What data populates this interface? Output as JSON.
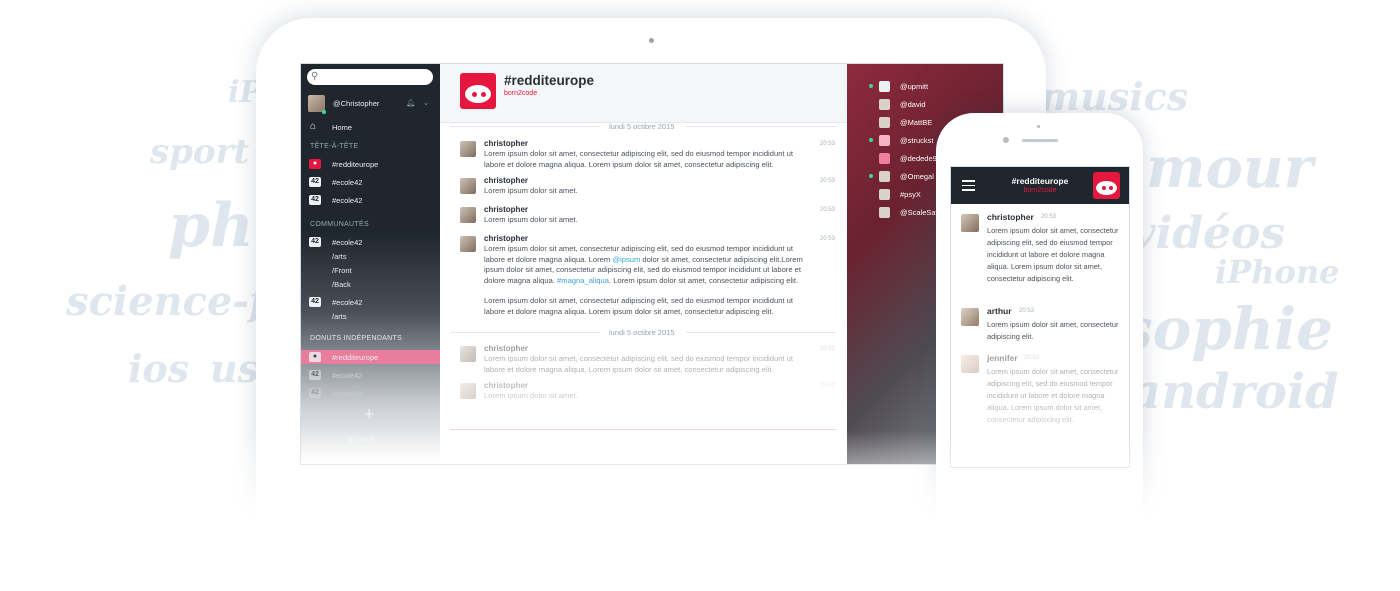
{
  "background_words": [
    "iPad",
    "sport",
    "philo",
    "science-fi",
    "ios",
    "us",
    "musics",
    "amour",
    "vidéos",
    "iPhone",
    "sophie",
    "android"
  ],
  "sidebar": {
    "search_placeholder": "",
    "user": "@Christopher",
    "home": "Home",
    "section_dm": "TÊTE-À-TÊTE",
    "dm_items": [
      "#redditeurope",
      "#ecole42",
      "#ecole42"
    ],
    "section_communities": "COMMUNAUTÉS",
    "community": {
      "name": "#ecole42",
      "subs": [
        "/arts",
        "/Front",
        "/Back"
      ]
    },
    "community2": {
      "name": "#ecole42",
      "subs": [
        "/arts"
      ]
    },
    "section_donuts": "DONUTS INDÉPENDANTS",
    "donut_items": [
      "#redditeurope",
      "#ecole42",
      "#ecole42"
    ],
    "add_label": "+",
    "logo_text": "donut"
  },
  "channel": {
    "name": "#redditeurope",
    "subtitle": "born2code",
    "date1": "lundi 5 octibre 2015",
    "date2": "lundi 5 octibre 2015",
    "messages": [
      {
        "author": "christopher",
        "time": "20:53",
        "text": "Lorem ipsum dolor sit amet, consectetur adipiscing elit, sed do eiusmod tempor incididunt ut labore et dolore magna aliqua. Lorem ipsum dolor sit amet, consectetur adipiscing elit."
      },
      {
        "author": "christopher",
        "time": "20:53",
        "text": "Lorem ipsum dolor sit amet."
      },
      {
        "author": "christopher",
        "time": "20:53",
        "text": "Lorem ipsum dolor sit amet."
      },
      {
        "author": "christopher",
        "time": "20:53",
        "text_a": "Lorem ipsum dolor sit amet, consectetur adipiscing elit, sed do eiusmod tempor incididunt ut labore et dolore magna aliqua. Lorem ",
        "link1": "@ipsum",
        "text_b": " dolor sit amet, consectetur adipiscing elit.Lorem ipsum dolor sit amet, consectetur adipiscing elit, sed do eiusmod tempor incididunt ut labore et dolore magna aliqua. ",
        "link2": "#magna_aliqua",
        "text_c": ". Lorem ipsum dolor sit amet, consectetur adipiscing elit.",
        "text2": "Lorem ipsum dolor sit amet, consectetur adipiscing elit, sed do eiusmod tempor incididunt ut labore et dolore magna aliqua. Lorem ipsum dolor sit amet, consectetur adipiscing elit."
      },
      {
        "author": "christopher",
        "time": "20:53",
        "text": "Lorem ipsum dolor sit amet, consectetur adipiscing elit, sed do eiusmod tempor incididunt ut labore et dolore magna aliqua. Lorem ipsum dolor sit amet, consectetur adipiscing elit."
      },
      {
        "author": "christopher",
        "time": "20:53",
        "text": "Lorem ipsum dolor sit amet."
      }
    ]
  },
  "members": [
    "@upmitt",
    "@david",
    "@MattBE",
    "@struckst",
    "@dedede9",
    "@Omegal",
    "#psyX",
    "@ScaleSav"
  ],
  "phone": {
    "title": "#redditeurope",
    "subtitle": "born2code",
    "messages": [
      {
        "author": "christopher",
        "time": "20:53",
        "text": "Lorem ipsum dolor sit amet, consectetur adipiscing elit, sed do eiusmod tempor incididunt ut labore et dolore magna aliqua. Lorem ipsum dolor sit amet, consectetur adipiscing elit."
      },
      {
        "author": "arthur",
        "time": "20:53",
        "text": "Lorem ipsum dolor sit amet, consectetur adipiscing elit."
      },
      {
        "author": "jennifer",
        "time": "20:53",
        "text": "Lorem ipsum dolor sit amet, consectetur adipiscing elit, sed do eiusmod tempor incididunt ut labore et dolore magna aliqua. Lorem ipsum dolor sit amet, consectetur adipiscing elit."
      }
    ]
  },
  "colors": {
    "accent": "#e5173f",
    "sidebar": "#1f262e",
    "link": "#3ba3d8",
    "selected": "#e97d9e",
    "online": "#3ed99a"
  }
}
